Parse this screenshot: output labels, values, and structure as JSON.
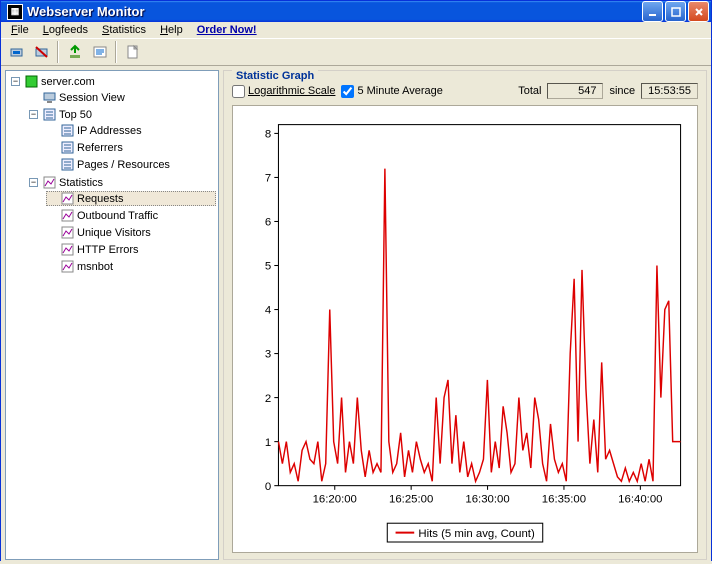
{
  "title": "Webserver Monitor",
  "menu": [
    "File",
    "Logfeeds",
    "Statistics",
    "Help",
    "Order Now!"
  ],
  "menu_keys": [
    "F",
    "L",
    "S",
    "H",
    ""
  ],
  "group_title": "Statistic Graph",
  "controls": {
    "log_scale": {
      "label": "Logarithmic Scale",
      "checked": false
    },
    "five_min": {
      "label": "5 Minute Average",
      "checked": true
    },
    "total_label": "Total",
    "total_value": "547",
    "since_label": "since",
    "since_value": "15:53:55"
  },
  "legend": "Hits (5 min avg, Count)",
  "tree": {
    "server": "server.com",
    "session": "Session View",
    "top50": "Top 50",
    "top50_children": [
      "IP Addresses",
      "Referrers",
      "Pages / Resources"
    ],
    "stats": "Statistics",
    "stats_children": [
      "Requests",
      "Outbound Traffic",
      "Unique Visitors",
      "HTTP Errors",
      "msnbot"
    ],
    "selected": "Requests"
  },
  "chart_data": {
    "type": "line",
    "xlabel": "",
    "ylabel": "",
    "ylim": [
      0,
      8.2
    ],
    "yticks": [
      0,
      1,
      2,
      3,
      4,
      5,
      6,
      7,
      8
    ],
    "xticks": [
      "16:20:00",
      "16:25:00",
      "16:30:00",
      "16:35:00",
      "16:40:00"
    ],
    "xtick_pos": [
      0.14,
      0.33,
      0.52,
      0.71,
      0.9
    ],
    "series": [
      {
        "name": "Hits (5 min avg, Count)",
        "color": "#d00",
        "values": [
          1.0,
          0.5,
          1.0,
          0.3,
          0.5,
          0.1,
          0.8,
          1.0,
          0.6,
          0.5,
          1.0,
          0.1,
          0.5,
          4.0,
          1.0,
          0.5,
          2.0,
          0.3,
          1.0,
          0.5,
          2.0,
          0.8,
          0.2,
          0.8,
          0.3,
          0.5,
          0.3,
          7.2,
          1.0,
          0.3,
          0.5,
          1.2,
          0.2,
          0.8,
          0.3,
          1.0,
          0.6,
          0.3,
          0.5,
          0.1,
          2.0,
          0.5,
          2.0,
          2.4,
          0.5,
          1.6,
          0.3,
          1.0,
          0.2,
          0.5,
          0.1,
          0.3,
          0.6,
          2.4,
          0.3,
          1.0,
          0.4,
          1.8,
          1.2,
          0.3,
          0.5,
          2.0,
          0.8,
          1.2,
          0.4,
          2.0,
          1.5,
          0.5,
          0.1,
          1.4,
          0.6,
          0.3,
          0.5,
          0.1,
          3.0,
          4.7,
          1.0,
          4.9,
          2.2,
          0.5,
          1.5,
          0.3,
          2.8,
          0.6,
          0.8,
          0.5,
          0.2,
          0.1,
          0.4,
          0.1,
          0.3,
          0.1,
          0.5,
          0.1,
          0.6,
          0.1,
          5.0,
          2.0,
          4.0,
          4.2,
          1.0,
          1.0,
          1.0
        ]
      }
    ]
  }
}
